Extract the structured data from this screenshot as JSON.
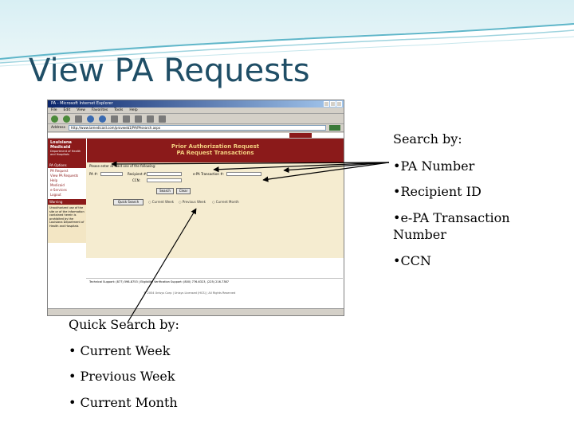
{
  "slide": {
    "title": "View PA Requests"
  },
  "browser": {
    "window_title": "PA - Microsoft Internet Explorer",
    "menu": [
      "File",
      "Edit",
      "View",
      "Favorites",
      "Tools",
      "Help"
    ],
    "address_label": "Address",
    "address_value": "http://www.lamedicaid.com/provweb1/PA/PAsearch.aspx"
  },
  "page": {
    "logo_line1": "Louisiana",
    "logo_line2": "Medicaid",
    "logo_line3": "Department of Health and Hospitals",
    "header_line1": "Prior Authorization Request",
    "header_line2": "PA Request Transactions",
    "nav_title": "PA Options",
    "nav_items": [
      "PA Request",
      "View PA Requests",
      "Help",
      "Medicaid",
      "e-Services",
      "Logout"
    ],
    "warning_title": "Warning",
    "warning_body": "Unauthorized use of the site or of the information contained herein is prohibited by the Louisiana Department of Health and Hospitals",
    "instruction": "Please enter at least one of the following:",
    "field_pa": "PA #:",
    "field_recipient": "Recipient #:",
    "field_epa": "e-PA Transaction #:",
    "field_ccn": "CCN:",
    "search_button": "Search",
    "clear_button": "Clear",
    "quick_search_button": "Quick Search",
    "radio_current_week": "Current Week",
    "radio_previous_week": "Previous Week",
    "radio_current_month": "Current Month",
    "footer_text": "Technical Support: (877) 598-8753  |  Eligibility Verification Support: (800) 776-6323, (225) 216-7387",
    "copyright": "© 2004 Unisys Corp    |    Unisys Licensed (HCS)    |    All Rights Reserved"
  },
  "callout_right": {
    "heading": "Search by:",
    "items": [
      "•PA Number",
      "•Recipient ID",
      "•e-PA Transaction",
      "Number",
      "•CCN"
    ]
  },
  "callout_left": {
    "heading": "Quick Search by:",
    "items": [
      "• Current Week",
      "• Previous Week",
      "• Current Month"
    ]
  },
  "colors": {
    "title": "#1f4e66",
    "brand_red": "#8b1a1a",
    "band": "#5fb6c9"
  }
}
